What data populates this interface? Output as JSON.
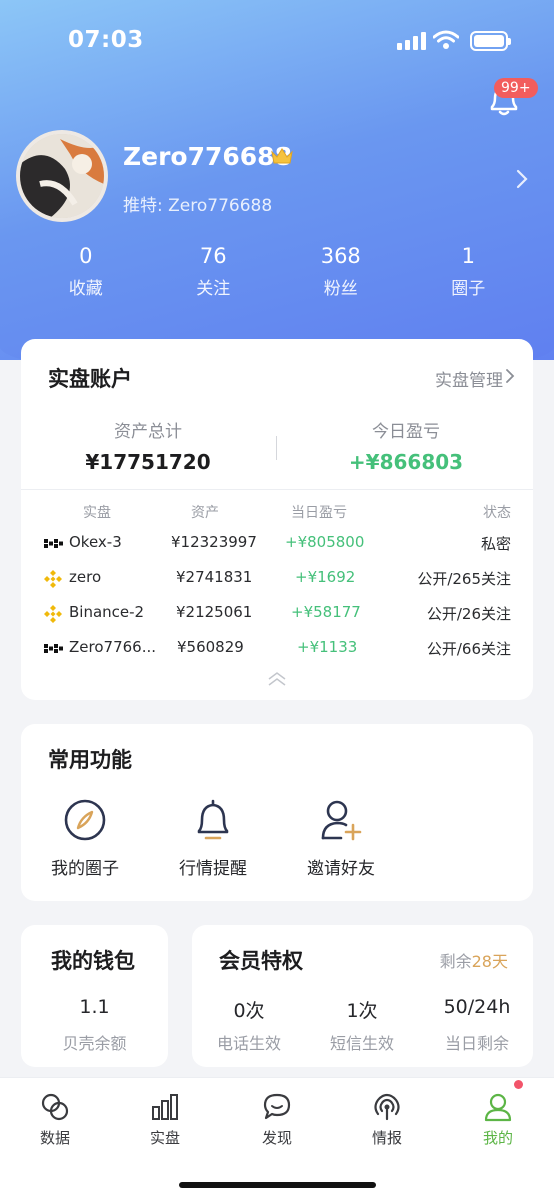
{
  "status_bar": {
    "time": "07:03"
  },
  "notifications": {
    "badge": "99+"
  },
  "profile": {
    "username": "Zero776688",
    "handle_label": "推特:",
    "handle_value": "Zero776688"
  },
  "stats": [
    {
      "value": "0",
      "label": "收藏"
    },
    {
      "value": "76",
      "label": "关注"
    },
    {
      "value": "368",
      "label": "粉丝"
    },
    {
      "value": "1",
      "label": "圈子"
    }
  ],
  "account": {
    "title": "实盘账户",
    "manage_label": "实盘管理",
    "total_label": "资产总计",
    "total_value": "¥17751720",
    "today_label": "今日盈亏",
    "today_value": "+¥866803",
    "columns": [
      "实盘",
      "资产",
      "当日盈亏",
      "状态"
    ],
    "rows": [
      {
        "exchange_icon": "okx-icon",
        "name": "Okex-3",
        "assets": "¥12323997",
        "pnl": "+¥805800",
        "status": "私密"
      },
      {
        "exchange_icon": "binance-icon",
        "name": "zero",
        "assets": "¥2741831",
        "pnl": "+¥1692",
        "status": "公开/265关注"
      },
      {
        "exchange_icon": "binance-icon",
        "name": "Binance-2",
        "assets": "¥2125061",
        "pnl": "+¥58177",
        "status": "公开/26关注"
      },
      {
        "exchange_icon": "okx-icon",
        "name": "Zero7766...",
        "assets": "¥560829",
        "pnl": "+¥1133",
        "status": "公开/66关注"
      }
    ]
  },
  "functions": {
    "title": "常用功能",
    "items": [
      {
        "icon": "compass-icon",
        "label": "我的圈子"
      },
      {
        "icon": "bell-icon",
        "label": "行情提醒"
      },
      {
        "icon": "add-user-icon",
        "label": "邀请好友"
      }
    ]
  },
  "wallet": {
    "title": "我的钱包",
    "value": "1.1",
    "label": "贝壳余额"
  },
  "vip": {
    "title": "会员特权",
    "remain_prefix": "剩余",
    "remain_days": "28天",
    "items": [
      {
        "value": "0次",
        "label": "电话生效"
      },
      {
        "value": "1次",
        "label": "短信生效"
      },
      {
        "value": "50/24h",
        "label": "当日剩余"
      }
    ]
  },
  "tabbar": [
    {
      "icon": "data-icon",
      "label": "数据"
    },
    {
      "icon": "bar-chart-icon",
      "label": "实盘"
    },
    {
      "icon": "chat-icon",
      "label": "发现"
    },
    {
      "icon": "broadcast-icon",
      "label": "情报"
    },
    {
      "icon": "user-icon",
      "label": "我的",
      "active": true
    }
  ],
  "colors": {
    "gain": "#45c07a",
    "accent_green": "#5cb546",
    "badge_red": "#f25d5d",
    "hero_blue": "#6a97f0",
    "gold": "#d9a45a"
  }
}
